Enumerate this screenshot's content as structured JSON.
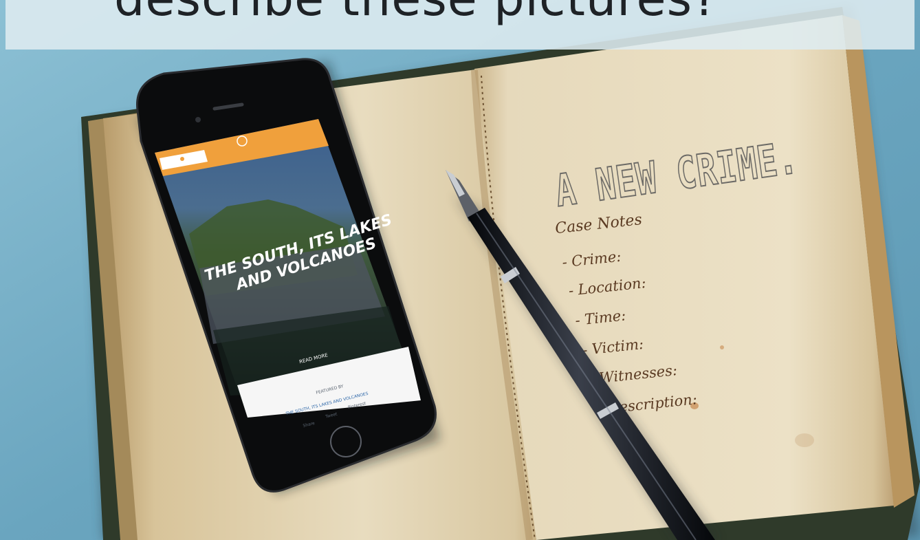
{
  "banner": {
    "title": "describe these pictures?"
  },
  "notebook": {
    "heading": "A NEW CRIME.",
    "case_notes_title": "Case Notes",
    "fields": [
      "- Crime:",
      "- Location:",
      "- Time:",
      "- Victim:",
      "- Witnesses:",
      "- Description:"
    ]
  },
  "phone": {
    "headline_line1": "THE SOUTH, ITS LAKES",
    "headline_line2": "AND VOLCANOES",
    "cta": "READ MORE",
    "byline": "FEATURED BY",
    "link": "THE SOUTH, ITS LAKES AND VOLCANOES",
    "share": [
      "Share",
      "Tweet",
      "Pinterest"
    ]
  },
  "colors": {
    "background": "#6fa9c2",
    "paper": "#e7d8b4",
    "phone_header": "#f0a03c",
    "phone_body": "#141414"
  }
}
